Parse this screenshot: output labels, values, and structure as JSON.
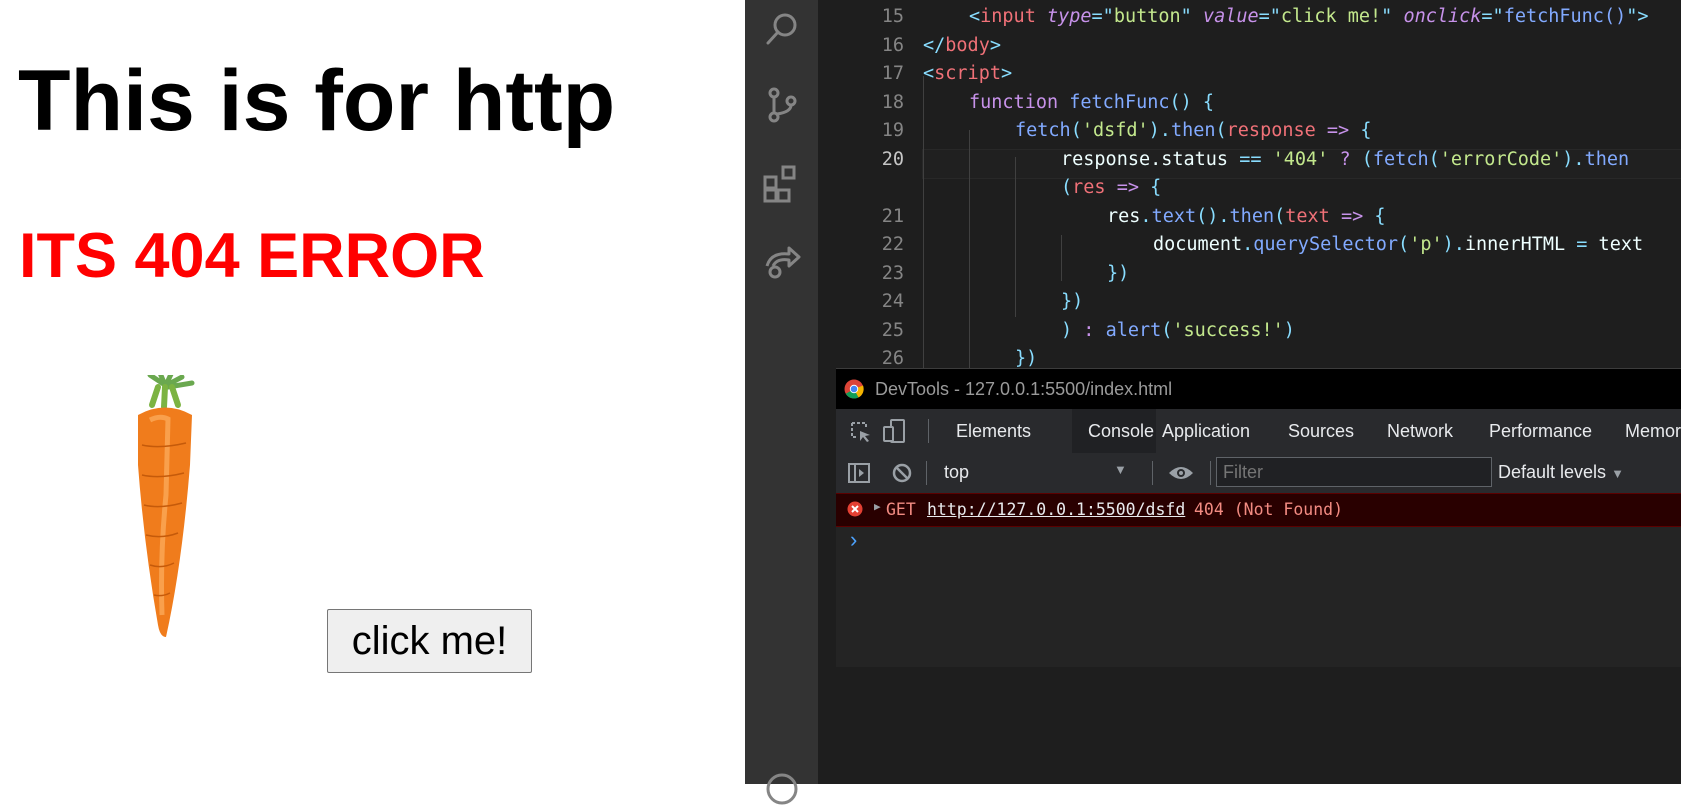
{
  "page": {
    "heading": "This is for http",
    "error_text": "ITS 404 ERROR",
    "button_label": "click me!"
  },
  "editor": {
    "lines": [
      {
        "num": "15",
        "tokens": [
          [
            "pn",
            "<"
          ],
          [
            "tn",
            "input"
          ],
          [
            "pl",
            " "
          ],
          [
            "attr",
            "type"
          ],
          [
            "pn",
            "=\""
          ],
          [
            "str",
            "button"
          ],
          [
            "pn",
            "\""
          ],
          [
            "pl",
            " "
          ],
          [
            "attr",
            "value"
          ],
          [
            "pn",
            "=\""
          ],
          [
            "str",
            "click me!"
          ],
          [
            "pn",
            "\""
          ],
          [
            "pl",
            " "
          ],
          [
            "attr",
            "onclick"
          ],
          [
            "pn",
            "=\""
          ],
          [
            "fn",
            "fetchFunc()"
          ],
          [
            "pn",
            "\">"
          ]
        ],
        "indent": 1
      },
      {
        "num": "16",
        "tokens": [
          [
            "pn",
            "</"
          ],
          [
            "tn",
            "body"
          ],
          [
            "pn",
            ">"
          ]
        ],
        "indent": 0
      },
      {
        "num": "17",
        "tokens": [
          [
            "pn",
            "<"
          ],
          [
            "tn",
            "script"
          ],
          [
            "pn",
            ">"
          ]
        ],
        "indent": 0
      },
      {
        "num": "18",
        "tokens": [
          [
            "kw",
            "function"
          ],
          [
            "pl",
            " "
          ],
          [
            "fn",
            "fetchFunc"
          ],
          [
            "pn",
            "()"
          ],
          [
            "pl",
            " "
          ],
          [
            "pn",
            "{"
          ]
        ],
        "indent": 1
      },
      {
        "num": "19",
        "tokens": [
          [
            "fn",
            "fetch"
          ],
          [
            "pn",
            "("
          ],
          [
            "str",
            "'dsfd'"
          ],
          [
            "pn",
            ")."
          ],
          [
            "fn",
            "then"
          ],
          [
            "pn",
            "("
          ],
          [
            "vr",
            "response"
          ],
          [
            "pl",
            " "
          ],
          [
            "kw",
            "=>"
          ],
          [
            "pl",
            " "
          ],
          [
            "pn",
            "{"
          ]
        ],
        "indent": 2
      },
      {
        "num": "20",
        "tokens": [
          [
            "pl",
            "response.status"
          ],
          [
            "pl",
            " "
          ],
          [
            "pn",
            "=="
          ],
          [
            "pl",
            " "
          ],
          [
            "str",
            "'404'"
          ],
          [
            "pl",
            " "
          ],
          [
            "kw",
            "?"
          ],
          [
            "pl",
            " "
          ],
          [
            "pn",
            "("
          ],
          [
            "fn",
            "fetch"
          ],
          [
            "pn",
            "("
          ],
          [
            "str",
            "'errorCode'"
          ],
          [
            "pn",
            ")."
          ],
          [
            "fn",
            "then"
          ]
        ],
        "indent": 3,
        "current": true
      },
      {
        "num": "",
        "tokens": [
          [
            "pn",
            "("
          ],
          [
            "vr",
            "res"
          ],
          [
            "pl",
            " "
          ],
          [
            "kw",
            "=>"
          ],
          [
            "pl",
            " "
          ],
          [
            "pn",
            "{"
          ]
        ],
        "indent": 3
      },
      {
        "num": "21",
        "tokens": [
          [
            "pl",
            "res"
          ],
          [
            "pn",
            "."
          ],
          [
            "fn",
            "text"
          ],
          [
            "pn",
            "()."
          ],
          [
            "fn",
            "then"
          ],
          [
            "pn",
            "("
          ],
          [
            "vr",
            "text"
          ],
          [
            "pl",
            " "
          ],
          [
            "kw",
            "=>"
          ],
          [
            "pl",
            " "
          ],
          [
            "pn",
            "{"
          ]
        ],
        "indent": 4
      },
      {
        "num": "22",
        "tokens": [
          [
            "pl",
            "document"
          ],
          [
            "pn",
            "."
          ],
          [
            "fn",
            "querySelector"
          ],
          [
            "pn",
            "("
          ],
          [
            "str",
            "'p'"
          ],
          [
            "pn",
            ")."
          ],
          [
            "pl",
            "innerHTML"
          ],
          [
            "pl",
            " "
          ],
          [
            "pn",
            "="
          ],
          [
            "pl",
            " text"
          ]
        ],
        "indent": 5
      },
      {
        "num": "23",
        "tokens": [
          [
            "pn",
            "})"
          ]
        ],
        "indent": 4
      },
      {
        "num": "24",
        "tokens": [
          [
            "pn",
            "})"
          ]
        ],
        "indent": 3
      },
      {
        "num": "25",
        "tokens": [
          [
            "pn",
            ")"
          ],
          [
            "pl",
            " "
          ],
          [
            "kw",
            ":"
          ],
          [
            "pl",
            " "
          ],
          [
            "fn",
            "alert"
          ],
          [
            "pn",
            "("
          ],
          [
            "str",
            "'success!'"
          ],
          [
            "pn",
            ")"
          ]
        ],
        "indent": 3
      },
      {
        "num": "26",
        "tokens": [
          [
            "pn",
            "})"
          ]
        ],
        "indent": 2
      }
    ]
  },
  "devtools": {
    "window_title": "DevTools - 127.0.0.1:5500/index.html",
    "tabs": [
      "Elements",
      "Console",
      "Application",
      "Sources",
      "Network",
      "Performance",
      "Memor"
    ],
    "active_tab": "Console",
    "context_select": "top",
    "filter_placeholder": "Filter",
    "levels": "Default levels",
    "error": {
      "method": "GET",
      "url": "http://127.0.0.1:5500/dsfd",
      "status": "404 (Not Found)"
    },
    "prompt": "›"
  },
  "colors": {
    "error_red": "#ff0000",
    "editor_bg": "#1e1e1e",
    "activity_bg": "#333333",
    "devtools_bg": "#242424"
  }
}
